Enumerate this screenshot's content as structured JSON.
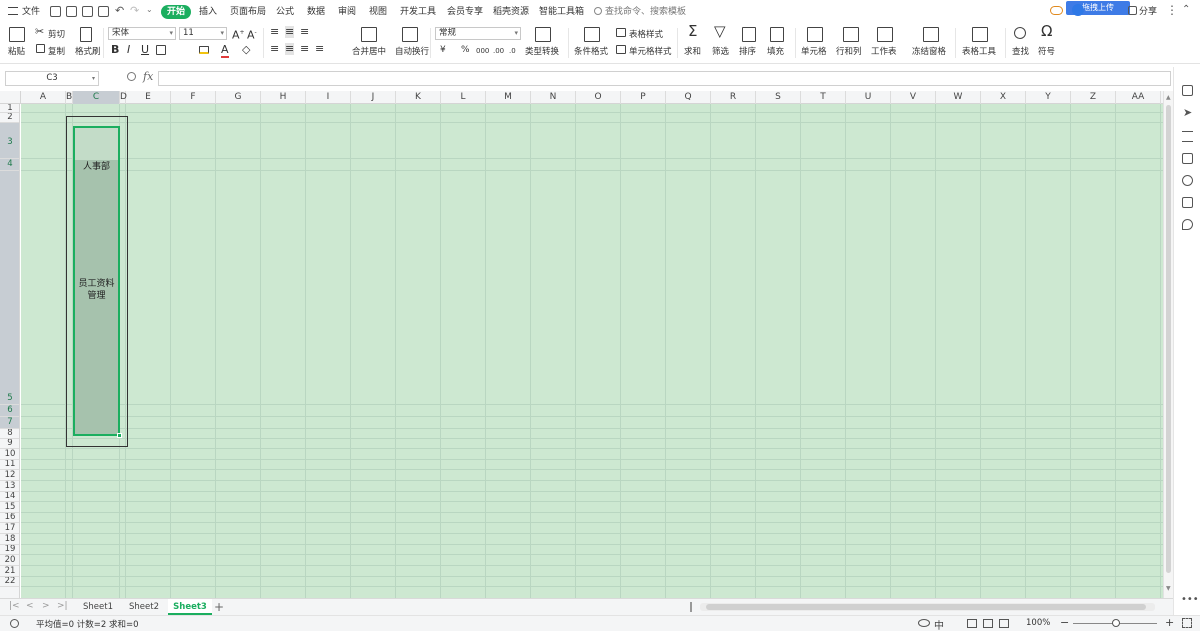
{
  "menubar": {
    "file": "文件",
    "tabs": [
      "开始",
      "插入",
      "页面布局",
      "公式",
      "数据",
      "审阅",
      "视图",
      "开发工具",
      "会员专享",
      "稻壳资源",
      "智能工具箱"
    ],
    "search_placeholder": "查找命令、搜索模板",
    "upload": "拖拽上传",
    "share": "分享"
  },
  "ribbon": {
    "paste": "粘贴",
    "cut": "剪切",
    "copy": "复制",
    "format_painter": "格式刷",
    "font_name": "宋体",
    "font_size": "11",
    "merge_center": "合并居中",
    "wrap_text": "自动换行",
    "number_format": "常规",
    "type_convert": "类型转换",
    "cond_format": "条件格式",
    "table_style": "表格样式",
    "cell_style": "单元格样式",
    "sum": "求和",
    "filter": "筛选",
    "sort": "排序",
    "fill": "填充",
    "cell": "单元格",
    "row_col": "行和列",
    "worksheet": "工作表",
    "freeze": "冻结窗格",
    "table_tools": "表格工具",
    "find": "查找",
    "symbol": "符号",
    "currency_symbol": "¥",
    "percent_symbol": "%",
    "thousands_symbol": "000",
    "dec_inc": ".00",
    "dec_dec": ".0"
  },
  "formula_bar": {
    "name_box": "C3",
    "fx": "fx",
    "content": ""
  },
  "columns": [
    "A",
    "B",
    "C",
    "D",
    "E",
    "F",
    "G",
    "H",
    "I",
    "J",
    "K",
    "L",
    "M",
    "N",
    "O",
    "P",
    "Q",
    "R",
    "S",
    "T",
    "U",
    "V",
    "W",
    "X",
    "Y",
    "Z",
    "AA"
  ],
  "rows": [
    "1",
    "2",
    "3",
    "4",
    "5",
    "6",
    "7",
    "8",
    "9",
    "10",
    "11",
    "12",
    "13",
    "14",
    "15",
    "16",
    "17",
    "18",
    "19",
    "20",
    "21",
    "22"
  ],
  "cells": {
    "c4": "人事部",
    "c5_line1": "员工资料",
    "c5_line2": "管理"
  },
  "sheets": [
    "Sheet1",
    "Sheet2",
    "Sheet3"
  ],
  "active_sheet": "Sheet3",
  "status": {
    "summary": "平均值=0  计数=2  求和=0",
    "zoom": "100%"
  },
  "colors": {
    "accent": "#1bae5f",
    "grid_bg": "#cde8d1",
    "upload_button": "#3e7be6"
  }
}
